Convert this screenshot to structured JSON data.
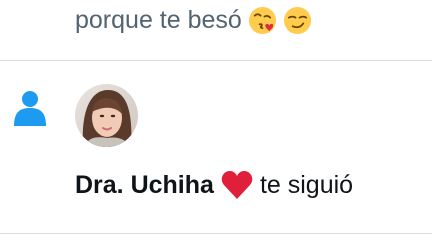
{
  "previous_notification": {
    "text": "porque te besó",
    "emojis": [
      "face-blowing-kiss-emoji",
      "smirking-face-emoji"
    ]
  },
  "follow_notification": {
    "icon": "person-icon",
    "user_name": "Dra. Uchiha",
    "name_emoji": "red-heart-emoji",
    "action_text": "te siguió"
  },
  "colors": {
    "accent": "#1d9bf0",
    "secondary_text": "#536471",
    "primary_text": "#0f1419",
    "divider": "#d7dde1",
    "heart": "#e0203a"
  }
}
